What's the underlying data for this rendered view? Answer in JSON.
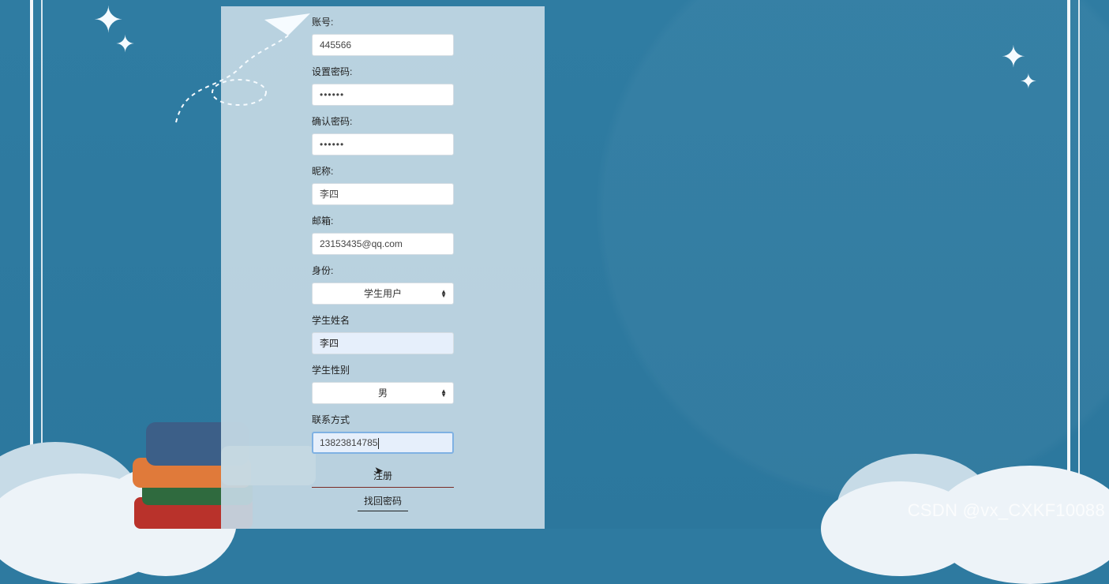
{
  "form": {
    "account": {
      "label": "账号:",
      "value": "445566"
    },
    "password": {
      "label": "设置密码:",
      "value": "••••••"
    },
    "confirm_password": {
      "label": "确认密码:",
      "value": "••••••"
    },
    "nickname": {
      "label": "昵称:",
      "value": "李四"
    },
    "email": {
      "label": "邮箱:",
      "value": "23153435@qq.com"
    },
    "identity": {
      "label": "身份:",
      "value": "学生用户"
    },
    "student_name": {
      "label": "学生姓名",
      "value": "李四"
    },
    "student_gender": {
      "label": "学生性别",
      "value": "男"
    },
    "contact": {
      "label": "联系方式",
      "value": "13823814785"
    },
    "register_label": "注册",
    "find_password_label": "找回密码"
  },
  "watermark": "CSDN @vx_CXKF10088",
  "decor": {
    "caret_icon": "updown-caret-icon",
    "sparkle_icon": "sparkle-star-icon"
  }
}
